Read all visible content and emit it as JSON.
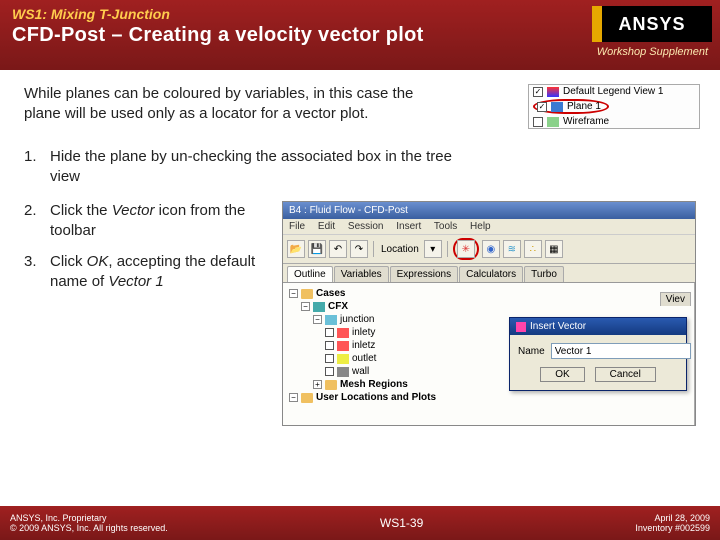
{
  "header": {
    "ws_label": "WS1: Mixing T-Junction",
    "title": "CFD-Post – Creating a velocity vector plot",
    "logo_text": "ANSYS",
    "supplement": "Workshop Supplement"
  },
  "intro": "While planes can be coloured by variables, in this case the plane will be used only as a locator for a vector plot.",
  "tree_snippet": {
    "row1": {
      "checked": "✓",
      "label": "Default Legend View 1"
    },
    "row2": {
      "checked": "✓",
      "label": "Plane 1"
    },
    "row3": {
      "checked": "",
      "label": "Wireframe"
    }
  },
  "steps": {
    "s1_num": "1.",
    "s1": "Hide the plane by un-checking the associated box in the tree view",
    "s2_num": "2.",
    "s2_a": "Click the ",
    "s2_b": "Vector",
    "s2_c": " icon from the toolbar",
    "s3_num": "3.",
    "s3_a": "Click ",
    "s3_b": "OK",
    "s3_c": ", accepting the default name of ",
    "s3_d": "Vector 1"
  },
  "app": {
    "title": "B4 : Fluid Flow - CFD-Post",
    "menu": {
      "file": "File",
      "edit": "Edit",
      "session": "Session",
      "insert": "Insert",
      "tools": "Tools",
      "help": "Help"
    },
    "location_label": "Location",
    "tabs": {
      "outline": "Outline",
      "variables": "Variables",
      "expressions": "Expressions",
      "calculators": "Calculators",
      "turbo": "Turbo"
    },
    "tree": {
      "cases": "Cases",
      "cfx": "CFX",
      "junction": "junction",
      "inlety": "inlety",
      "inletz": "inletz",
      "outlet": "outlet",
      "wall": "wall",
      "mesh": "Mesh Regions",
      "userloc": "User Locations and Plots"
    },
    "view_tab": "Viev",
    "dialog": {
      "title": "Insert Vector",
      "name_label": "Name",
      "name_value": "Vector 1",
      "ok": "OK",
      "cancel": "Cancel"
    }
  },
  "footer": {
    "left1": "ANSYS, Inc. Proprietary",
    "left2": "© 2009 ANSYS, Inc.  All rights reserved.",
    "center": "WS1-39",
    "right1": "April 28, 2009",
    "right2": "Inventory #002599"
  }
}
